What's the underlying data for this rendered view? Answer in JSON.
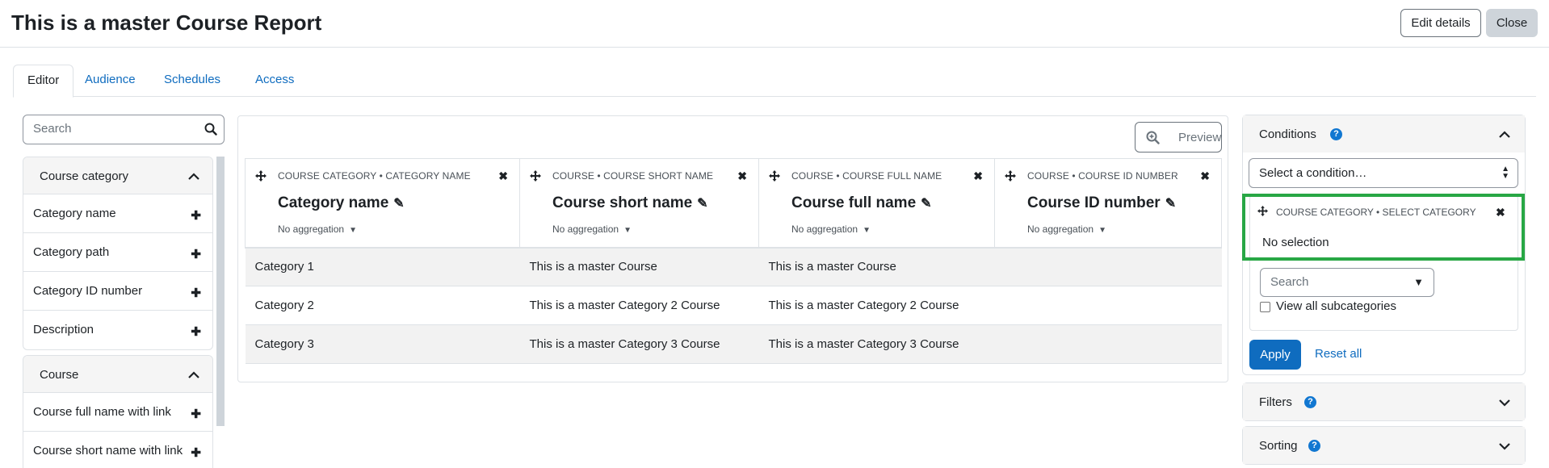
{
  "page": {
    "title": "This is a master Course Report",
    "edit_details_label": "Edit details",
    "close_label": "Close"
  },
  "tabs": [
    {
      "label": "Editor",
      "active": true
    },
    {
      "label": "Audience",
      "active": false
    },
    {
      "label": "Schedules",
      "active": false
    },
    {
      "label": "Access",
      "active": false
    }
  ],
  "sidebar": {
    "search_placeholder": "Search",
    "groups": [
      {
        "title": "Course category",
        "items": [
          "Category name",
          "Category path",
          "Category ID number",
          "Description"
        ]
      },
      {
        "title": "Course",
        "items": [
          "Course full name with link",
          "Course short name with link"
        ]
      }
    ]
  },
  "report": {
    "preview_label": "Preview",
    "columns": [
      {
        "label": "COURSE CATEGORY • CATEGORY NAME",
        "title": "Category name",
        "aggregation": "No aggregation"
      },
      {
        "label": "COURSE • COURSE SHORT NAME",
        "title": "Course short name",
        "aggregation": "No aggregation"
      },
      {
        "label": "COURSE • COURSE FULL NAME",
        "title": "Course full name",
        "aggregation": "No aggregation"
      },
      {
        "label": "COURSE • COURSE ID NUMBER",
        "title": "Course ID number",
        "aggregation": "No aggregation"
      }
    ],
    "rows": [
      [
        "Category 1",
        "This is a master Course",
        "This is a master Course",
        ""
      ],
      [
        "Category 2",
        "This is a master Category 2 Course",
        "This is a master Category 2 Course",
        ""
      ],
      [
        "Category 3",
        "This is a master Category 3 Course",
        "This is a master Category 3 Course",
        ""
      ]
    ]
  },
  "conditions": {
    "title": "Conditions",
    "select_placeholder": "Select a condition…",
    "active_condition": {
      "label": "COURSE CATEGORY • SELECT CATEGORY",
      "value": "No selection",
      "search_placeholder": "Search",
      "checkbox_label": "View all subcategories"
    },
    "apply_label": "Apply",
    "reset_label": "Reset all"
  },
  "filters": {
    "title": "Filters"
  },
  "sorting": {
    "title": "Sorting"
  },
  "colors": {
    "link": "#0f6cbf",
    "highlight": "#28a745",
    "help_icon": "#1177d1"
  }
}
